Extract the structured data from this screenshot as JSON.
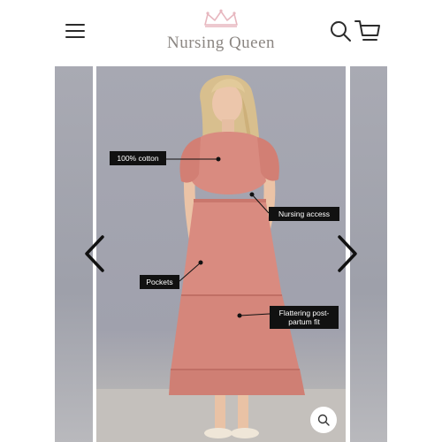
{
  "header": {
    "menu_icon": "hamburger-menu-icon",
    "logo_text": "Nursing Queen",
    "logo_icon": "crown-icon",
    "search_icon": "search-icon",
    "cart_icon": "cart-icon",
    "brand_color": "#e7b7bf"
  },
  "gallery": {
    "prev_icon": "chevron-left-icon",
    "next_icon": "chevron-right-icon",
    "zoom_icon": "zoom-icon",
    "dress_color": "#d98b80",
    "callouts": {
      "cotton": "100% cotton",
      "nursing": "Nursing access",
      "pockets": "Pockets",
      "flattering": "Flattering post-partum fit"
    }
  }
}
